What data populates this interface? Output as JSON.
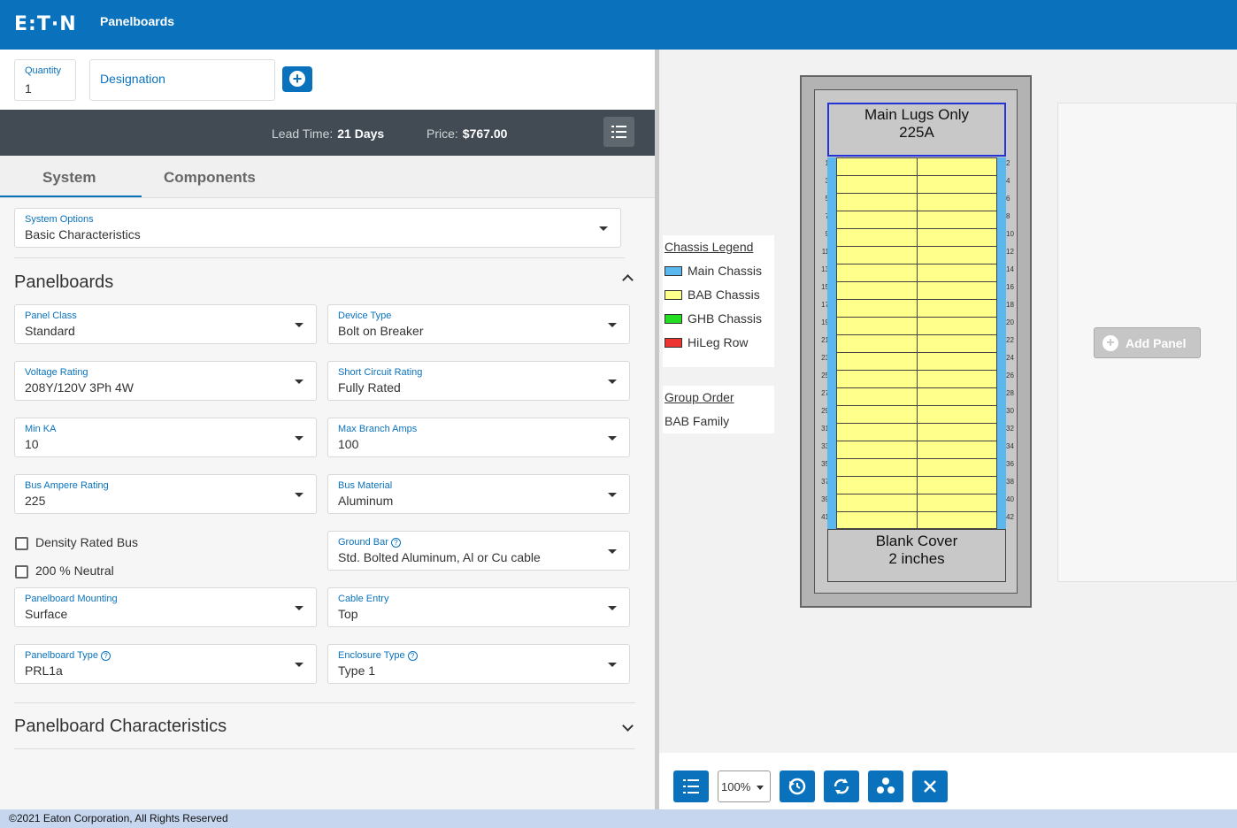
{
  "header": {
    "logo": "E:T·N",
    "title": "Panelboards"
  },
  "quantity": {
    "label": "Quantity",
    "value": "1"
  },
  "designation": {
    "placeholder": "Designation"
  },
  "summary": {
    "lead_label": "Lead Time:",
    "lead_value": "21 Days",
    "price_label": "Price:",
    "price_value": "$767.00"
  },
  "tabs": [
    {
      "label": "System"
    },
    {
      "label": "Components"
    }
  ],
  "system_options": {
    "label": "System Options",
    "value": "Basic Characteristics"
  },
  "sections": {
    "panelboards": "Panelboards",
    "characteristics": "Panelboard Characteristics"
  },
  "fields": {
    "panel_class": {
      "label": "Panel Class",
      "value": "Standard"
    },
    "device_type": {
      "label": "Device Type",
      "value": "Bolt on Breaker"
    },
    "voltage_rating": {
      "label": "Voltage Rating",
      "value": "208Y/120V 3Ph 4W"
    },
    "short_circuit_rating": {
      "label": "Short Circuit Rating",
      "value": "Fully Rated"
    },
    "min_ka": {
      "label": "Min KA",
      "value": "10"
    },
    "max_branch_amps": {
      "label": "Max Branch Amps",
      "value": "100"
    },
    "bus_ampere_rating": {
      "label": "Bus Ampere Rating",
      "value": "225"
    },
    "bus_material": {
      "label": "Bus Material",
      "value": "Aluminum"
    },
    "ground_bar": {
      "label": "Ground Bar",
      "value": "Std. Bolted Aluminum, Al or Cu cable"
    },
    "panelboard_mounting": {
      "label": "Panelboard Mounting",
      "value": "Surface"
    },
    "cable_entry": {
      "label": "Cable Entry",
      "value": "Top"
    },
    "panelboard_type": {
      "label": "Panelboard Type",
      "value": "PRL1a"
    },
    "enclosure_type": {
      "label": "Enclosure Type",
      "value": "Type 1"
    }
  },
  "checkboxes": {
    "density_rated_bus": "Density Rated Bus",
    "neutral_200": "200 % Neutral"
  },
  "panel_drawing": {
    "main_line1": "Main Lugs Only",
    "main_line2": "225A",
    "blank_line1": "Blank Cover",
    "blank_line2": "2 inches",
    "left_numbers": [
      "1",
      "3",
      "5",
      "7",
      "9",
      "11",
      "13",
      "15",
      "17",
      "19",
      "21",
      "23",
      "25",
      "27",
      "29",
      "31",
      "33",
      "35",
      "37",
      "39",
      "41"
    ],
    "right_numbers": [
      "2",
      "4",
      "6",
      "8",
      "10",
      "12",
      "14",
      "16",
      "18",
      "20",
      "22",
      "24",
      "26",
      "28",
      "30",
      "32",
      "34",
      "36",
      "38",
      "40",
      "42"
    ],
    "colors": {
      "main_chassis": "#5bb8ee",
      "bab_chassis": "#ffff8c"
    }
  },
  "legend": {
    "title": "Chassis Legend",
    "items": [
      {
        "label": "Main Chassis",
        "color": "#5bb8ee"
      },
      {
        "label": "BAB Chassis",
        "color": "#ffff8c"
      },
      {
        "label": "GHB Chassis",
        "color": "#22dd22"
      },
      {
        "label": "HiLeg Row",
        "color": "#ee3333"
      }
    ]
  },
  "group_order": {
    "title": "Group Order",
    "value": "BAB Family"
  },
  "add_panel": {
    "label": "Add Panel"
  },
  "toolbar": {
    "zoom": "100%",
    "icons": [
      "list-icon",
      "history-icon",
      "refresh-icon",
      "group-icon",
      "close-icon"
    ]
  },
  "footer": {
    "text": "©2021 Eaton Corporation, All Rights Reserved"
  }
}
